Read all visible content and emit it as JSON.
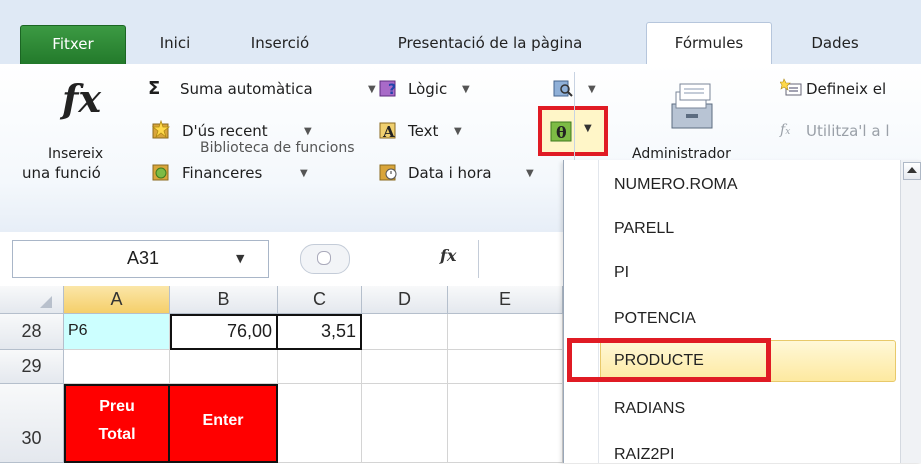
{
  "tabs": [
    "Fitxer",
    "Inici",
    "Inserció",
    "Presentació de la pàgina",
    "Fórmules",
    "Dades"
  ],
  "active_tab": "Fórmules",
  "ribbon": {
    "insert_function": {
      "symbol": "fx",
      "line1": "Insereix",
      "line2": "una funció"
    },
    "autosum": "Suma automàtica",
    "autosum_symbol": "Σ",
    "recent": "D'ús recent",
    "financial": "Financeres",
    "logical": "Lògic",
    "text": "Text",
    "datetime": "Data i hora",
    "group_label": "Biblioteca de funcions",
    "name_manager": "Administrador",
    "define_name": "Defineix el",
    "use_in_formula": "Utilitza'l a l",
    "theta_symbol": "θ"
  },
  "formula_bar": {
    "name_box": "A31",
    "fx": "fx"
  },
  "sheet": {
    "columns": [
      "A",
      "B",
      "C",
      "D",
      "E"
    ],
    "rows": [
      {
        "num": "28",
        "A": "P6",
        "B": "76,00",
        "C": "3,51"
      },
      {
        "num": "29"
      },
      {
        "num": "30",
        "A_line1": "Preu",
        "A_line2": "Total",
        "B": "Enter"
      }
    ]
  },
  "dropdown": {
    "items": [
      "NUMERO.ROMA",
      "PARELL",
      "PI",
      "POTENCIA",
      "PRODUCTE",
      "RADIANS",
      "RAIZ2PI"
    ],
    "highlighted": "PRODUCTE"
  },
  "colors": {
    "highlight_box": "#e01b24",
    "cell_cyan": "#ccffff",
    "cell_red": "#ff0000",
    "fitxer_green": "#2e8b36"
  }
}
